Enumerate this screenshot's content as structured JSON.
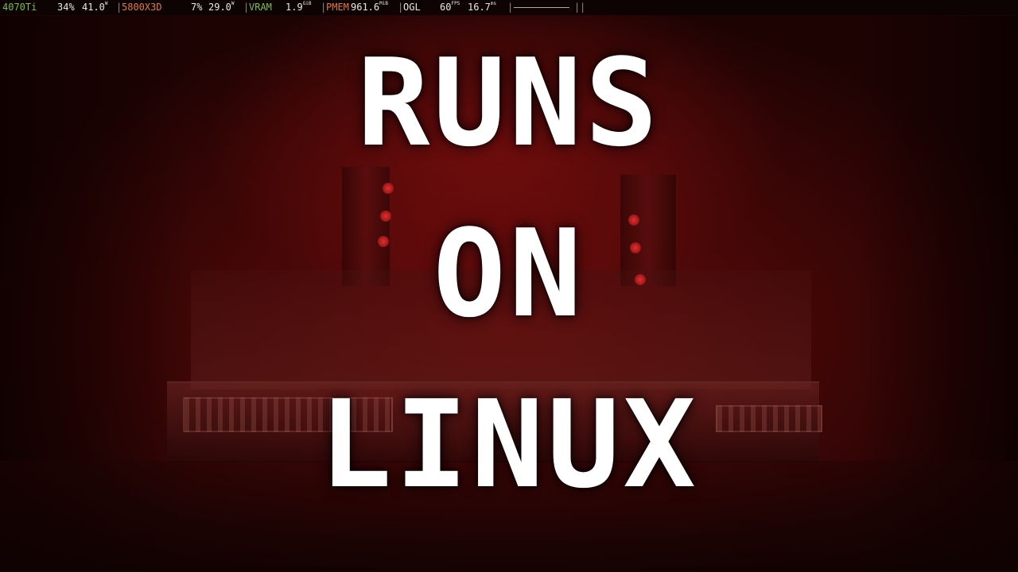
{
  "hud": {
    "gpu_name": "4070Ti",
    "gpu_load": "34%",
    "gpu_power": "41.0",
    "gpu_power_unit": "W",
    "cpu_name": "5800X3D",
    "cpu_load": "7%",
    "cpu_power": "29.0",
    "cpu_power_unit": "W",
    "vram_label": "VRAM",
    "vram_value": "1.9",
    "vram_unit": "GiB",
    "pmem_label": "PMEM",
    "pmem_value": "961.6",
    "pmem_unit": "MiB",
    "api": "OGL",
    "fps": "60",
    "fps_unit": "FPS",
    "frametime": "16.7",
    "frametime_unit": "ms",
    "separator": "|"
  },
  "overlay": {
    "line1": "RUNS",
    "line2": "ON",
    "line3": "LINUX"
  },
  "colors": {
    "gpu_label": "#7fbf3f",
    "cpu_label": "#e07a3a",
    "background": "#3a0606",
    "title_text": "#ffffff"
  }
}
